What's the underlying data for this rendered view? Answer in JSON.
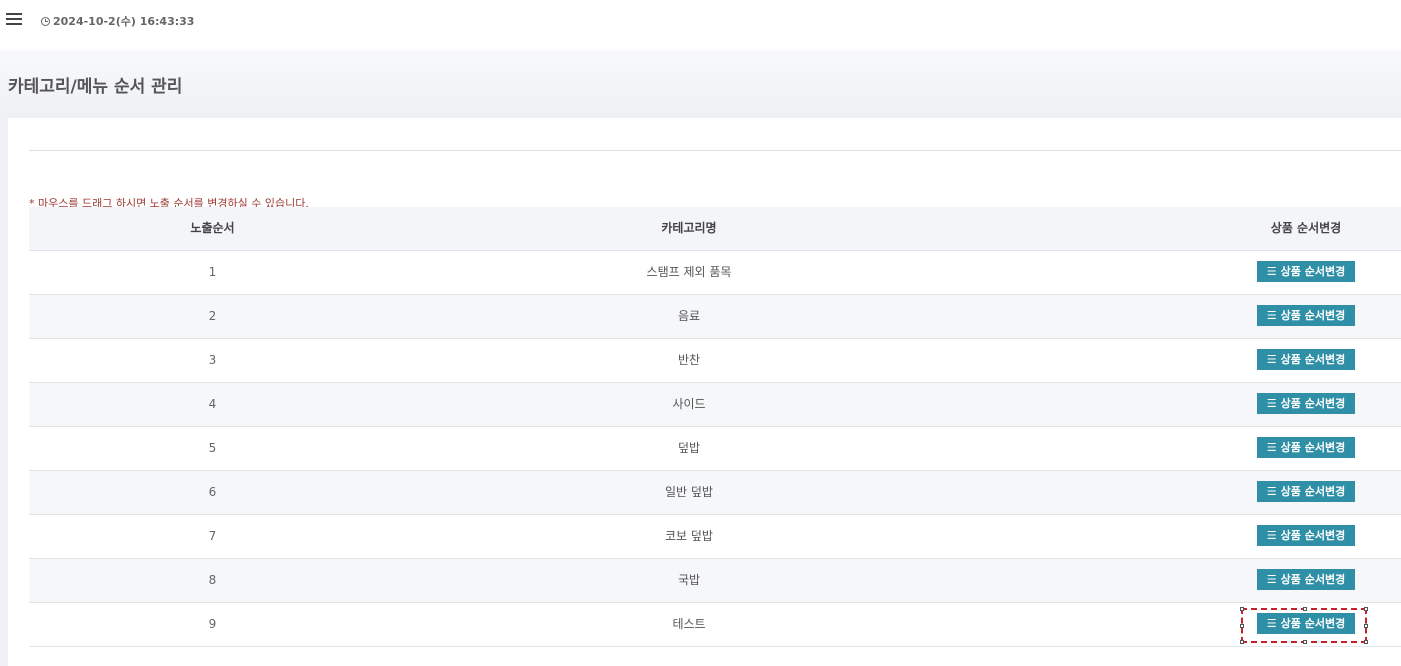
{
  "topbar": {
    "datetime": "2024-10-2(수) 16:43:33"
  },
  "page": {
    "title": "카테고리/메뉴 순서 관리",
    "notice": "* 마우스를 드래그 하시면 노출 순서를 변경하실 수 있습니다."
  },
  "table": {
    "headers": [
      "노출순서",
      "카테고리명",
      "상품 순서변경"
    ],
    "button_label": "상품 순서변경",
    "rows": [
      {
        "order": "1",
        "name": "스탬프 제외 품목"
      },
      {
        "order": "2",
        "name": "음료"
      },
      {
        "order": "3",
        "name": "반찬"
      },
      {
        "order": "4",
        "name": "사이드"
      },
      {
        "order": "5",
        "name": "덮밥"
      },
      {
        "order": "6",
        "name": "일반 덮밥"
      },
      {
        "order": "7",
        "name": "코보 덮밥"
      },
      {
        "order": "8",
        "name": "국밥"
      },
      {
        "order": "9",
        "name": "테스트"
      }
    ]
  },
  "colors": {
    "button_bg": "#2f8fa6",
    "notice_text": "#9b3a34",
    "highlight_border": "#c8202a"
  },
  "icons": {
    "menu": "hamburger-icon",
    "clock": "clock-icon",
    "list": "list-icon"
  }
}
